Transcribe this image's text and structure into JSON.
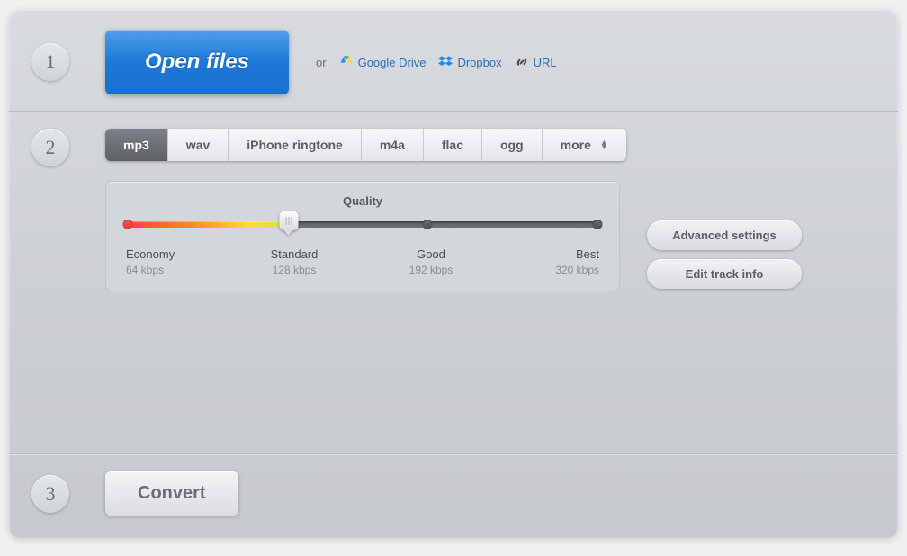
{
  "step1": {
    "num": "1",
    "open_label": "Open files",
    "or_text": "or",
    "sources": {
      "gdrive": "Google Drive",
      "dropbox": "Dropbox",
      "url": "URL"
    }
  },
  "step2": {
    "num": "2",
    "formats": [
      "mp3",
      "wav",
      "iPhone ringtone",
      "m4a",
      "flac",
      "ogg"
    ],
    "more_label": "more",
    "quality": {
      "title": "Quality",
      "levels": [
        {
          "name": "Economy",
          "bitrate": "64 kbps"
        },
        {
          "name": "Standard",
          "bitrate": "128 kbps"
        },
        {
          "name": "Good",
          "bitrate": "192 kbps"
        },
        {
          "name": "Best",
          "bitrate": "320 kbps"
        }
      ],
      "selected_index": 1
    },
    "advanced_label": "Advanced settings",
    "track_info_label": "Edit track info"
  },
  "step3": {
    "num": "3",
    "convert_label": "Convert"
  }
}
